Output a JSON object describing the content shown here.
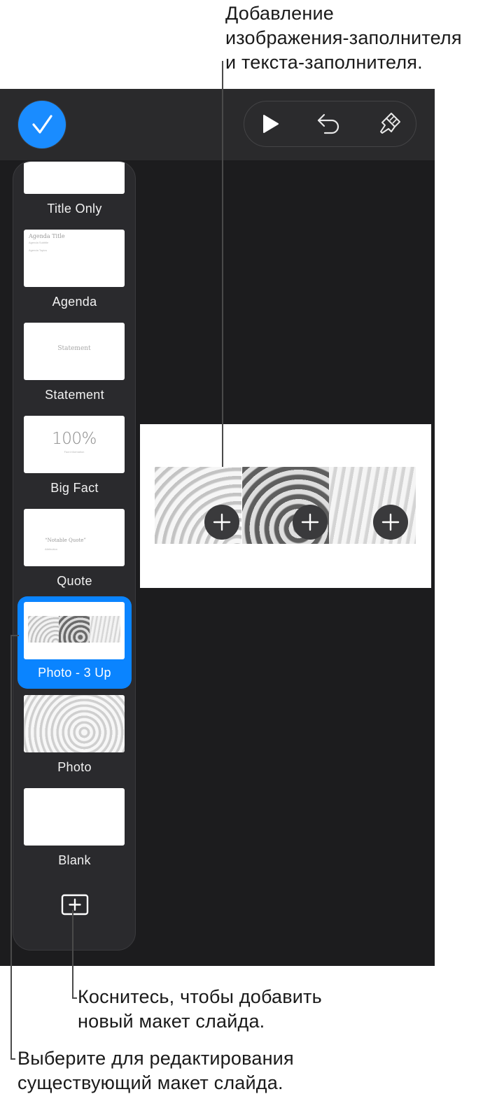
{
  "annotations": {
    "top": "Добавление\nизображения-заполнителя\nи текста-заполнителя.",
    "add_layout": "Коснитесь, чтобы добавить\nновый макет слайда.",
    "edit_layout": "Выберите для редактирования\nсуществующий макет слайда."
  },
  "toolbar": {
    "done_icon": "checkmark-icon",
    "play_icon": "play-icon",
    "undo_icon": "undo-icon",
    "format_icon": "paintbrush-icon",
    "accent_color": "#1a8cff"
  },
  "layouts": [
    {
      "label": "Title Only",
      "thumb_text": ""
    },
    {
      "label": "Agenda",
      "thumb_title": "Agenda Title",
      "thumb_subtitle": "Agenda Subtitle",
      "thumb_topics": "Agenda Topics"
    },
    {
      "label": "Statement",
      "thumb_text": "Statement"
    },
    {
      "label": "Big Fact",
      "thumb_text": "100%",
      "thumb_sub": "Fact information"
    },
    {
      "label": "Quote",
      "thumb_text": "“Notable Quote”",
      "thumb_sub": "Attribution"
    },
    {
      "label": "Photo - 3 Up",
      "selected": true
    },
    {
      "label": "Photo"
    },
    {
      "label": "Blank"
    }
  ],
  "add_layout_icon": "add-layout-icon",
  "slide": {
    "placeholders": [
      "plus-icon",
      "plus-icon",
      "plus-icon"
    ]
  }
}
